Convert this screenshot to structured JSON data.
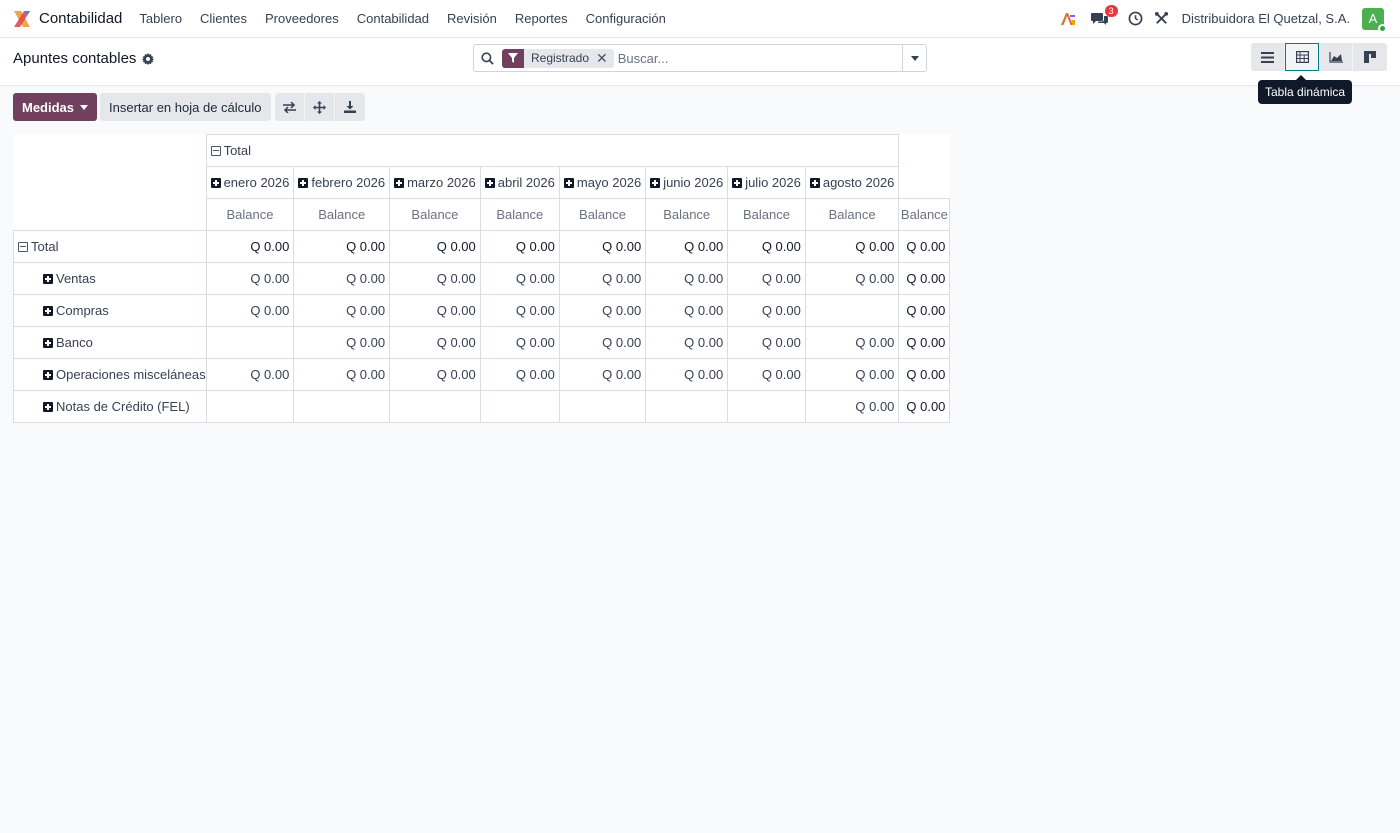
{
  "app": {
    "name": "Contabilidad"
  },
  "menu": [
    "Tablero",
    "Clientes",
    "Proveedores",
    "Contabilidad",
    "Revisión",
    "Reportes",
    "Configuración"
  ],
  "nav": {
    "messages_badge": "3",
    "company": "Distribuidora El Quetzal, S.A.",
    "avatar_letter": "A"
  },
  "page": {
    "title": "Apuntes contables"
  },
  "search": {
    "facet": "Registrado",
    "placeholder": "Buscar..."
  },
  "views": {
    "tooltip": "Tabla dinámica",
    "active": "pivot"
  },
  "toolbar": {
    "measures_label": "Medidas",
    "insert_label": "Insertar en hoja de cálculo"
  },
  "pivot": {
    "col_total": "Total",
    "months": [
      "enero 2026",
      "febrero 2026",
      "marzo 2026",
      "abril 2026",
      "mayo 2026",
      "junio 2026",
      "julio 2026",
      "agosto 2026"
    ],
    "measure": "Balance",
    "row_total": {
      "label": "Total",
      "values": [
        "Q 0.00",
        "Q 0.00",
        "Q 0.00",
        "Q 0.00",
        "Q 0.00",
        "Q 0.00",
        "Q 0.00",
        "Q 0.00",
        "Q 0.00"
      ]
    },
    "rows": [
      {
        "label": "Ventas",
        "values": [
          "Q 0.00",
          "Q 0.00",
          "Q 0.00",
          "Q 0.00",
          "Q 0.00",
          "Q 0.00",
          "Q 0.00",
          "Q 0.00",
          "Q 0.00"
        ]
      },
      {
        "label": "Compras",
        "values": [
          "Q 0.00",
          "Q 0.00",
          "Q 0.00",
          "Q 0.00",
          "Q 0.00",
          "Q 0.00",
          "Q 0.00",
          "",
          "Q 0.00"
        ]
      },
      {
        "label": "Banco",
        "values": [
          "",
          "Q 0.00",
          "Q 0.00",
          "Q 0.00",
          "Q 0.00",
          "Q 0.00",
          "Q 0.00",
          "Q 0.00",
          "Q 0.00"
        ]
      },
      {
        "label": "Operaciones misceláneas",
        "values": [
          "Q 0.00",
          "Q 0.00",
          "Q 0.00",
          "Q 0.00",
          "Q 0.00",
          "Q 0.00",
          "Q 0.00",
          "Q 0.00",
          "Q 0.00"
        ]
      },
      {
        "label": "Notas de Crédito (FEL)",
        "values": [
          "",
          "",
          "",
          "",
          "",
          "",
          "",
          "Q 0.00",
          "Q 0.00"
        ]
      }
    ]
  }
}
